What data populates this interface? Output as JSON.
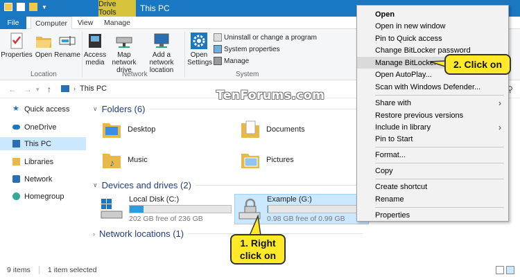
{
  "window": {
    "title": "This PC",
    "context_tab_header": "Drive Tools"
  },
  "tabs": [
    {
      "label": "File"
    },
    {
      "label": "Computer"
    },
    {
      "label": "View"
    },
    {
      "label": "Manage"
    }
  ],
  "ribbon": {
    "properties": "Properties",
    "open": "Open",
    "rename": "Rename",
    "access_media": "Access media",
    "map_network_drive": "Map network drive",
    "add_network_location": "Add a network location",
    "open_settings": "Open Settings",
    "uninstall": "Uninstall or change a program",
    "system_properties": "System properties",
    "manage": "Manage",
    "groups": {
      "location": "Location",
      "network": "Network",
      "system": "System"
    }
  },
  "address": {
    "path": "This PC"
  },
  "sidebar": {
    "items": [
      {
        "label": "Quick access"
      },
      {
        "label": "OneDrive"
      },
      {
        "label": "This PC"
      },
      {
        "label": "Libraries"
      },
      {
        "label": "Network"
      },
      {
        "label": "Homegroup"
      }
    ]
  },
  "content": {
    "folders_header": "Folders (6)",
    "devices_header": "Devices and drives (2)",
    "network_header": "Network locations (1)",
    "folders": [
      {
        "label": "Desktop"
      },
      {
        "label": "Documents"
      },
      {
        "label": "Music"
      },
      {
        "label": "Pictures"
      }
    ],
    "drives": [
      {
        "name": "Local Disk (C:)",
        "free": "202 GB free of 236 GB",
        "used_fraction": 0.14
      },
      {
        "name": "Example (G:)",
        "free": "0.98 GB free of 0.99 GB",
        "used_fraction": 0.01
      }
    ]
  },
  "status": {
    "items": "9 items",
    "selected": "1 item selected"
  },
  "watermark": "TenForums.com",
  "context_menu": {
    "items": [
      {
        "label": "Open"
      },
      {
        "label": "Open in new window"
      },
      {
        "label": "Pin to Quick access"
      },
      {
        "label": "Change BitLocker password"
      },
      {
        "label": "Manage BitLocker"
      },
      {
        "label": "Open AutoPlay..."
      },
      {
        "label": "Scan with Windows Defender..."
      },
      {
        "label": "Share with"
      },
      {
        "label": "Restore previous versions"
      },
      {
        "label": "Include in library"
      },
      {
        "label": "Pin to Start"
      },
      {
        "label": "Format..."
      },
      {
        "label": "Copy"
      },
      {
        "label": "Create shortcut"
      },
      {
        "label": "Rename"
      },
      {
        "label": "Properties"
      }
    ]
  },
  "callouts": {
    "step1_line1": "1. Right",
    "step1_line2": "click on",
    "step2": "2. Click on"
  },
  "colors": {
    "accent": "#1a78c2",
    "selection": "#cce8ff",
    "callout": "#ffe928",
    "drive_bar": "#26a0da"
  }
}
